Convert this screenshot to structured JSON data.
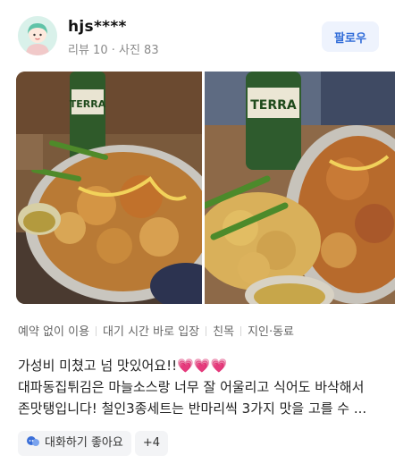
{
  "user": {
    "name": "hjs****",
    "stats": "리뷰 10 · 사진 83",
    "follow_label": "팔로우"
  },
  "tags": [
    "예약 없이 이용",
    "대기 시간 바로 입장",
    "친목",
    "지인·동료"
  ],
  "review": {
    "line1": "가성비 미쳤고 넘 맛있어요!!",
    "line1_emoji": "💗💗💗",
    "line2": "대파동집튀김은 마늘소스랑 너무 잘 어울리고 식어도 바삭해서",
    "line3": "존맛탱입니다! 철인3종세트는 반마리씩 3가지 맛을 고를 수 ..."
  },
  "chips": {
    "keyword_label": "대화하기 좋아요",
    "more_label": "+4"
  },
  "photos": {
    "bottle_label": "TERRA"
  },
  "colors": {
    "accent": "#2f6bd8",
    "follow_bg": "#eef3fd",
    "muted_text": "#8a8a8a"
  }
}
